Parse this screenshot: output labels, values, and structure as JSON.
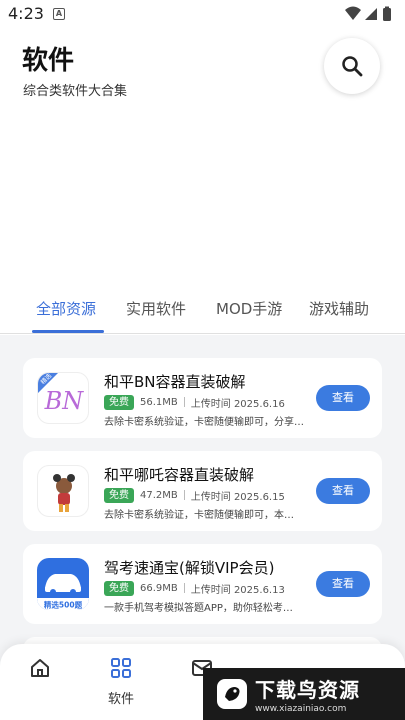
{
  "status_bar": {
    "time": "4:23",
    "notif_glyph": "A"
  },
  "header": {
    "title": "软件",
    "subtitle": "综合类软件大合集"
  },
  "tabs": [
    {
      "label": "全部资源",
      "active": true
    },
    {
      "label": "实用软件",
      "active": false
    },
    {
      "label": "MOD手游",
      "active": false
    },
    {
      "label": "游戏辅助",
      "active": false
    }
  ],
  "apps": [
    {
      "name": "和平BN容器直装破解",
      "badge": "免费",
      "size": "56.1MB",
      "upload": "上传时间 2025.6.16",
      "desc": "去除卡密系统验证，卡密随便输即可，分享…",
      "button": "查看",
      "icon": "bn-logo-icon",
      "icon_text": "BN",
      "ribbon": "精选"
    },
    {
      "name": "和平哪吒容器直装破解",
      "badge": "免费",
      "size": "47.2MB",
      "upload": "上传时间 2025.6.15",
      "desc": "去除卡密系统验证，卡密随便输即可，本…",
      "button": "查看",
      "icon": "nezha-character-icon"
    },
    {
      "name": "驾考速通宝(解锁VIP会员)",
      "badge": "免费",
      "size": "66.9MB",
      "upload": "上传时间 2025.6.13",
      "desc": "一款手机驾考模拟答题APP，助你轻松考…",
      "button": "查看",
      "icon": "car-logo-icon",
      "icon_text": "精选500题"
    }
  ],
  "bottom_nav": [
    {
      "label": "",
      "icon": "home-icon"
    },
    {
      "label": "软件",
      "icon": "grid-icon"
    },
    {
      "label": "",
      "icon": "mail-icon"
    }
  ],
  "watermark": {
    "title": "下载鸟资源",
    "url": "www.xiazainiao.com"
  },
  "colors": {
    "accent": "#3b6fd8",
    "button": "#3b7be0",
    "badge": "#3aa657",
    "list_bg": "#f3f4f6"
  }
}
